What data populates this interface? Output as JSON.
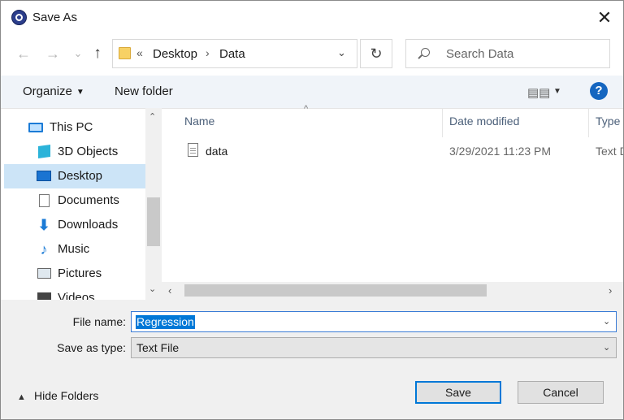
{
  "window": {
    "title": "Save As",
    "app_icon": "app-globe-icon",
    "close_icon": "close-icon"
  },
  "address_bar": {
    "overflow_chevron": "«",
    "segments": [
      "Desktop",
      "Data"
    ],
    "separator": "›",
    "refresh_icon": "refresh-icon",
    "search_placeholder": "Search Data"
  },
  "nav_buttons": {
    "back": "←",
    "forward": "→",
    "recent": "⌄",
    "up": "↑"
  },
  "toolbar": {
    "organize": "Organize",
    "new_folder": "New folder",
    "view_icon": "view-details-icon",
    "help": "?"
  },
  "nav_pane": {
    "items": [
      {
        "label": "This PC",
        "icon": "this-pc-icon",
        "selected": false
      },
      {
        "label": "3D Objects",
        "icon": "3d-objects-icon",
        "selected": false
      },
      {
        "label": "Desktop",
        "icon": "desktop-icon",
        "selected": true
      },
      {
        "label": "Documents",
        "icon": "documents-icon",
        "selected": false
      },
      {
        "label": "Downloads",
        "icon": "downloads-icon",
        "selected": false
      },
      {
        "label": "Music",
        "icon": "music-icon",
        "selected": false
      },
      {
        "label": "Pictures",
        "icon": "pictures-icon",
        "selected": false
      },
      {
        "label": "Videos",
        "icon": "videos-icon",
        "selected": false
      }
    ]
  },
  "file_list": {
    "columns": [
      "Name",
      "Date modified",
      "Type"
    ],
    "rows": [
      {
        "name": "data",
        "date_modified": "3/29/2021 11:23 PM",
        "type": "Text Document",
        "icon": "text-file-icon"
      }
    ]
  },
  "form": {
    "file_name_label": "File name:",
    "file_name_value": "Regression",
    "save_as_type_label": "Save as type:",
    "save_as_type_value": "Text File"
  },
  "footer": {
    "hide_folders": "Hide Folders",
    "save": "Save",
    "cancel": "Cancel"
  },
  "colors": {
    "accent": "#0078d7",
    "toolbar_bg": "#f0f4f9",
    "selected_bg": "#cce4f7",
    "panel_bg": "#f0f0f0",
    "help_blue": "#1566c0"
  }
}
